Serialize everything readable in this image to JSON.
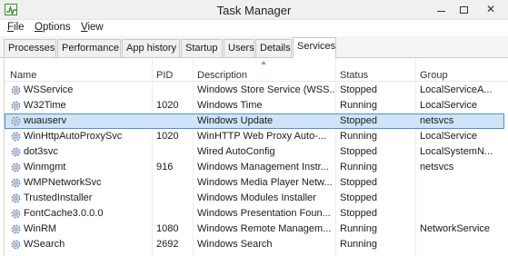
{
  "window": {
    "title": "Task Manager"
  },
  "menu": [
    {
      "mnemonic": "F",
      "rest": "ile"
    },
    {
      "mnemonic": "O",
      "rest": "ptions"
    },
    {
      "mnemonic": "V",
      "rest": "iew"
    }
  ],
  "tabs": [
    "Processes",
    "Performance",
    "App history",
    "Startup",
    "Users",
    "Details",
    "Services"
  ],
  "active_tab": "Services",
  "columns": {
    "name": "Name",
    "pid": "PID",
    "description": "Description",
    "status": "Status",
    "group": "Group"
  },
  "rows": [
    {
      "name": "WSService",
      "pid": "",
      "description": "Windows Store Service (WSS...",
      "status": "Stopped",
      "group": "LocalServiceA..."
    },
    {
      "name": "W32Time",
      "pid": "1020",
      "description": "Windows Time",
      "status": "Running",
      "group": "LocalService"
    },
    {
      "name": "wuauserv",
      "pid": "",
      "description": "Windows Update",
      "status": "Stopped",
      "group": "netsvcs"
    },
    {
      "name": "WinHttpAutoProxySvc",
      "pid": "1020",
      "description": "WinHTTP Web Proxy Auto-...",
      "status": "Running",
      "group": "LocalService"
    },
    {
      "name": "dot3svc",
      "pid": "",
      "description": "Wired AutoConfig",
      "status": "Stopped",
      "group": "LocalSystemN..."
    },
    {
      "name": "Winmgmt",
      "pid": "916",
      "description": "Windows Management Instr...",
      "status": "Running",
      "group": "netsvcs"
    },
    {
      "name": "WMPNetworkSvc",
      "pid": "",
      "description": "Windows Media Player Netw...",
      "status": "Stopped",
      "group": ""
    },
    {
      "name": "TrustedInstaller",
      "pid": "",
      "description": "Windows Modules Installer",
      "status": "Stopped",
      "group": ""
    },
    {
      "name": "FontCache3.0.0.0",
      "pid": "",
      "description": "Windows Presentation Foun...",
      "status": "Stopped",
      "group": ""
    },
    {
      "name": "WinRM",
      "pid": "1080",
      "description": "Windows Remote Managem...",
      "status": "Running",
      "group": "NetworkService"
    },
    {
      "name": "WSearch",
      "pid": "2692",
      "description": "Windows Search",
      "status": "Running",
      "group": ""
    }
  ],
  "selected_row": 2,
  "icons": {
    "app": "task-manager-icon",
    "service": "service-gear-icon"
  },
  "colors": {
    "selection_bg": "#cfe4f7",
    "selection_border": "#4d8fd1",
    "close_hover": "#e81123"
  }
}
